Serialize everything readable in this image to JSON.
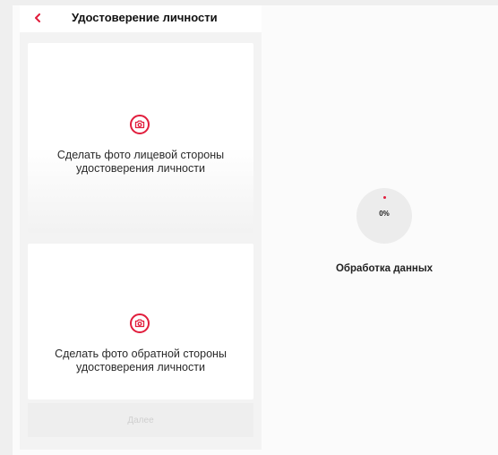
{
  "header": {
    "title": "Удостоверение личности",
    "back_icon": "chevron-left-icon"
  },
  "cards": {
    "front": {
      "icon": "camera-icon",
      "line1": "Сделать фото лицевой стороны",
      "line2": "удостоверения личности"
    },
    "back": {
      "icon": "camera-icon",
      "line1": "Сделать фото обратной стороны",
      "line2": "удостоверения личности"
    }
  },
  "next_button": {
    "label": "Далее",
    "state": "disabled"
  },
  "processing": {
    "percent_text": "0%",
    "percent_value": 0,
    "label": "Обработка данных"
  },
  "colors": {
    "accent": "#e11d3c",
    "background": "#fbfbfb",
    "card": "#ffffff",
    "button_disabled": "#eeeeee",
    "progress_bg": "#ececec"
  }
}
